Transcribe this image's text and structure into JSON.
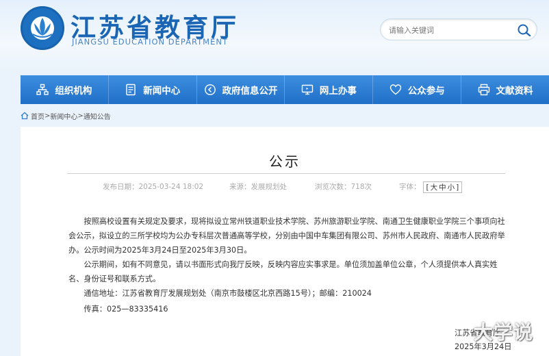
{
  "header": {
    "site_title": "江苏省教育厅",
    "site_subtitle": "JIANGSU EDUCATION DEPARTMENT",
    "search_placeholder": "请输入关键词"
  },
  "nav": [
    {
      "label": "组织机构",
      "icon": "org-chart-icon"
    },
    {
      "label": "新闻中心",
      "icon": "news-icon"
    },
    {
      "label": "政府信息公开",
      "icon": "info-disclosure-icon"
    },
    {
      "label": "网上办事",
      "icon": "online-service-icon"
    },
    {
      "label": "公众参与",
      "icon": "heart-icon"
    },
    {
      "label": "文献资料",
      "icon": "printer-icon"
    }
  ],
  "breadcrumb": {
    "home": "首页",
    "sep": ">",
    "level1": "新闻中心",
    "level2": "通知公告"
  },
  "article": {
    "title": "公示",
    "meta": {
      "publish_label": "发布日期：",
      "publish_value": "2025-03-24 18:02",
      "source_label": "来源：",
      "source_value": "发展规划处",
      "views_label": "浏览次数：",
      "views_value": "718次",
      "font_label": "字体：",
      "font_bracket_open": "[",
      "font_sizes": [
        "大",
        "中",
        "小"
      ],
      "font_bracket_close": "]"
    },
    "paragraphs": [
      "按照高校设置有关规定及要求，现将拟设立常州铁道职业技术学院、苏州旅游职业学院、南通卫生健康职业学院三个事项向社会公示，拟设立的三所学校均为公办专科层次普通高等学校，分别由中国中车集团有限公司、苏州市人民政府、南通市人民政府举办。公示时间为2025年3月24日至2025年3月30日。",
      "公示期间，如有不同意见，请以书面形式向我厅反映，反映内容应实事求是。单位须加盖单位公章，个人须提供本人真实姓名、身份证号和联系方式。"
    ],
    "address": "通信地址：江苏省教育厅发展规划处（南京市鼓楼区北京西路15号）；邮编：210024",
    "fax": "传真：025—83335416",
    "sign_org": "江苏省教育厅",
    "sign_date": "2025年3月24日"
  },
  "watermark": "大学说",
  "colors": {
    "brand_blue": "#1b66b4",
    "nav_top": "#3d8ee0",
    "nav_bottom": "#1f6fc7",
    "page_bg": "#eaf3fb"
  }
}
